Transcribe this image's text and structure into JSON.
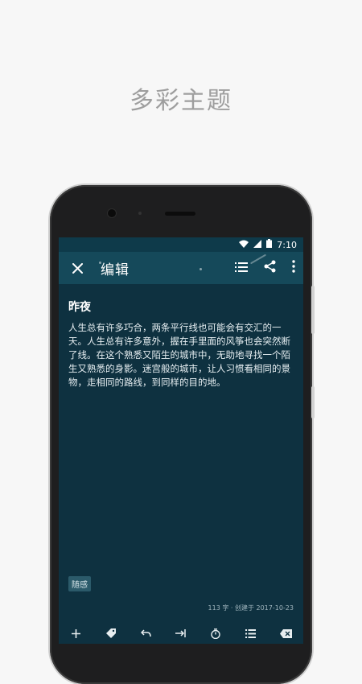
{
  "headline": "多彩主题",
  "status_bar": {
    "time": "7:10"
  },
  "app_bar": {
    "title": "编辑"
  },
  "note": {
    "title": "昨夜",
    "body": "人生总有许多巧合，两条平行线也可能会有交汇的一天。人生总有许多意外，握在手里面的风筝也会突然断了线。在这个熟悉又陌生的城市中，无助地寻找一个陌生又熟悉的身影。迷宫般的城市，让人习惯看相同的景物，走相同的路线，到同样的目的地。",
    "tag": "随感",
    "meta": "113 字 · 创建于 2017-10-23"
  },
  "colors": {
    "screen_bg": "#0e3140",
    "app_bar_bg": "#15495a",
    "tag_bg": "#2b5a6a"
  },
  "toolbar_icons": [
    "plus-icon",
    "tag-icon",
    "undo-icon",
    "indent-icon",
    "timer-icon",
    "list-icon",
    "backspace-icon"
  ]
}
